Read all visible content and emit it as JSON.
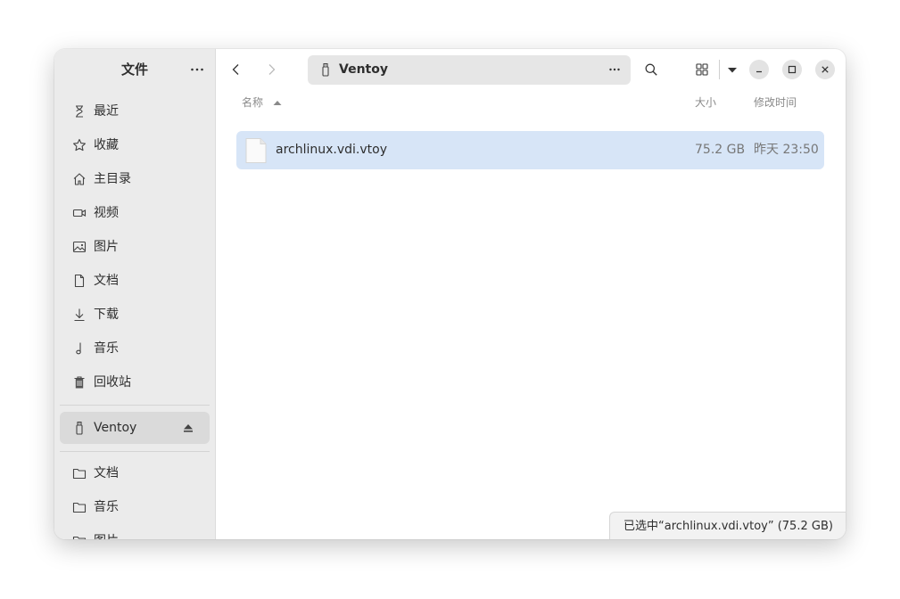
{
  "sidebar": {
    "title": "文件",
    "places": [
      {
        "label": "最近",
        "icon": "recent-icon"
      },
      {
        "label": "收藏",
        "icon": "star-icon"
      },
      {
        "label": "主目录",
        "icon": "home-icon"
      },
      {
        "label": "视频",
        "icon": "video-icon"
      },
      {
        "label": "图片",
        "icon": "image-icon"
      },
      {
        "label": "文档",
        "icon": "document-icon"
      },
      {
        "label": "下载",
        "icon": "download-icon"
      },
      {
        "label": "音乐",
        "icon": "music-icon"
      },
      {
        "label": "回收站",
        "icon": "trash-icon"
      }
    ],
    "devices": [
      {
        "label": "Ventoy",
        "icon": "usb-drive-icon",
        "selected": true
      }
    ],
    "bookmarks": [
      {
        "label": "文档",
        "icon": "folder-icon"
      },
      {
        "label": "音乐",
        "icon": "folder-icon"
      },
      {
        "label": "图片",
        "icon": "folder-icon"
      }
    ]
  },
  "header": {
    "location": "Ventoy"
  },
  "columns": {
    "name": "名称",
    "size": "大小",
    "modified": "修改时间"
  },
  "files": [
    {
      "name": "archlinux.vdi.vtoy",
      "size": "75.2 GB",
      "modified": "昨天 23:50",
      "selected": true
    }
  ],
  "status": {
    "text": "已选中“archlinux.vdi.vtoy” (75.2 GB)"
  },
  "colors": {
    "accent_selection": "#d7e5f7",
    "sidebar_bg": "#ebebeb"
  }
}
